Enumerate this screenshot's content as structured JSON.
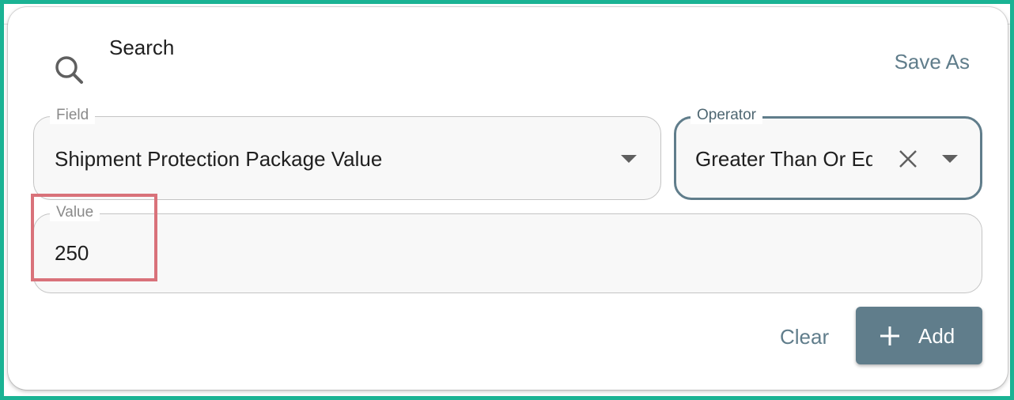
{
  "dialog": {
    "title": "Search",
    "icons": {
      "search": "search-icon",
      "clear": "close-icon",
      "dropdown": "chevron-down-icon",
      "add": "plus-icon"
    },
    "save_as_label": "Save As"
  },
  "filters": {
    "field": {
      "label": "Field",
      "value": "Shipment Protection Package Value"
    },
    "operator": {
      "label": "Operator",
      "value": "Greater Than Or Equal To"
    },
    "value": {
      "label": "Value",
      "value": "250"
    }
  },
  "actions": {
    "clear_label": "Clear",
    "add_label": "Add"
  },
  "colors": {
    "accent": "#607d8b",
    "frame": "#1ab394",
    "highlight": "#d9727a"
  }
}
